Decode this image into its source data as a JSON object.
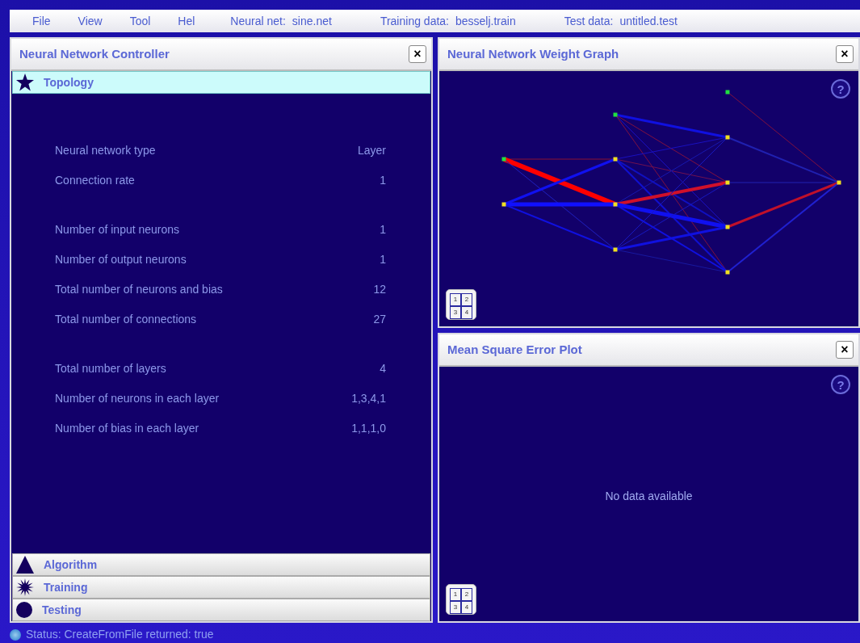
{
  "menu": [
    {
      "label": "File"
    },
    {
      "label": "View"
    },
    {
      "label": "Tool"
    },
    {
      "label": "Hel"
    }
  ],
  "files": [
    {
      "label": "Neural net:",
      "value": "sine.net"
    },
    {
      "label": "Training data:",
      "value": "besselj.train"
    },
    {
      "label": "Test data:",
      "value": "untitled.test"
    }
  ],
  "controller": {
    "title": "Neural Network Controller",
    "close": "×",
    "sections": [
      {
        "kind": "star",
        "label": "Topology",
        "selected": true
      },
      {
        "kind": "triangle",
        "label": "Algorithm",
        "selected": false
      },
      {
        "kind": "burst",
        "label": "Training",
        "selected": false
      },
      {
        "kind": "circle",
        "label": "Testing",
        "selected": false
      }
    ],
    "property_groups": [
      [
        {
          "label": "Neural network type",
          "value": "Layer"
        },
        {
          "label": "Connection rate",
          "value": "1"
        }
      ],
      [
        {
          "label": "Number of input neurons",
          "value": "1"
        },
        {
          "label": "Number of output neurons",
          "value": "1"
        },
        {
          "label": "Total number of neurons and bias",
          "value": "12"
        },
        {
          "label": "Total number of connections",
          "value": "27"
        }
      ],
      [
        {
          "label": "Total number of layers",
          "value": "4"
        },
        {
          "label": "Number of neurons in each layer",
          "value": "1,3,4,1"
        },
        {
          "label": "Number of bias in each layer",
          "value": "1,1,1,0"
        }
      ]
    ]
  },
  "weight_graph": {
    "title": "Neural Network Weight Graph",
    "close": "×",
    "help": "?",
    "layout_button": [
      "1",
      "2",
      "3",
      "4"
    ]
  },
  "error_plot": {
    "title": "Mean Square Error Plot",
    "close": "×",
    "help": "?",
    "message": "No data available",
    "layout_button": [
      "1",
      "2",
      "3",
      "4"
    ]
  },
  "status": "Status: CreateFromFile returned: true"
}
